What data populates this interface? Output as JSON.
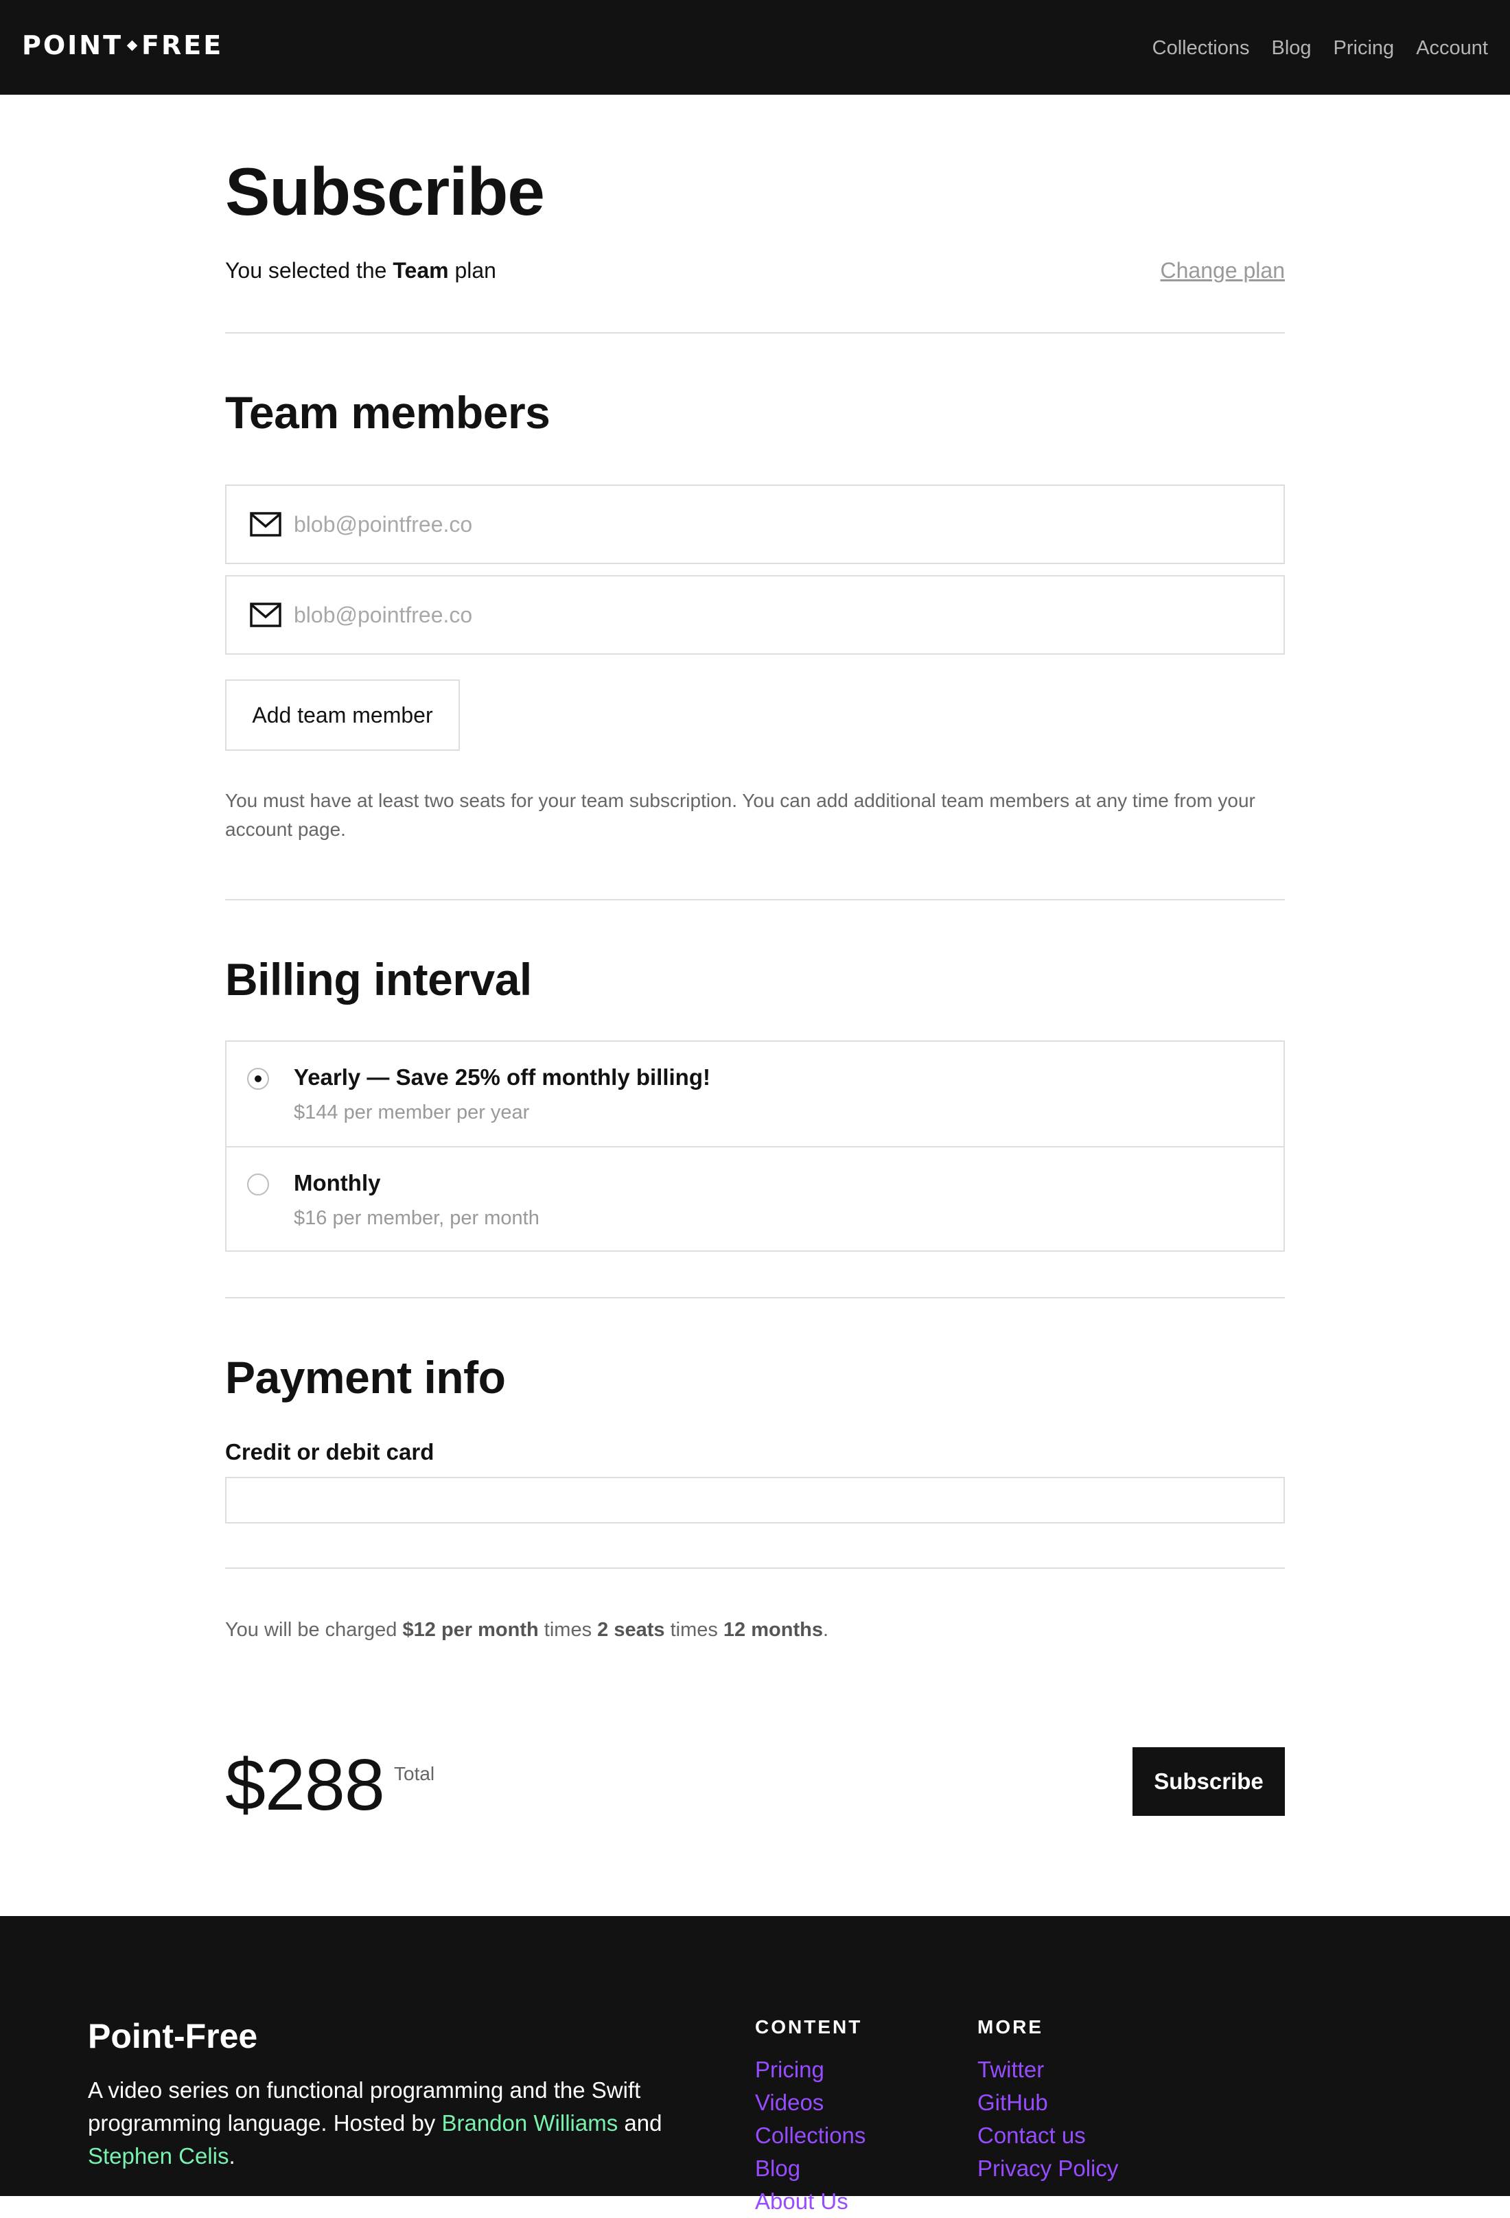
{
  "header": {
    "logo_left": "POINT",
    "logo_right": "FREE",
    "nav": [
      "Collections",
      "Blog",
      "Pricing",
      "Account"
    ]
  },
  "subscribe": {
    "title": "Subscribe",
    "plan_prefix": "You selected the",
    "plan_name": "Team",
    "plan_suffix": "plan",
    "change_plan": "Change plan"
  },
  "team": {
    "title": "Team members",
    "emails": [
      {
        "value": "",
        "placeholder": "blob@pointfree.co"
      },
      {
        "value": "",
        "placeholder": "blob@pointfree.co"
      }
    ],
    "add_button": "Add team member",
    "note": "You must have at least two seats for your team subscription. You can add additional team members at any time from your account page."
  },
  "billing": {
    "title": "Billing interval",
    "options": [
      {
        "title": "Yearly — Save 25% off monthly billing!",
        "subtitle": "$144 per member per year",
        "selected": true
      },
      {
        "title": "Monthly",
        "subtitle": "$16 per member, per month",
        "selected": false
      }
    ]
  },
  "payment": {
    "title": "Payment info",
    "card_label": "Credit or debit card",
    "card_value": ""
  },
  "summary": {
    "prefix": "You will be charged",
    "rate": "$12 per month",
    "times1": "times",
    "seats": "2 seats",
    "times2": "times",
    "months": "12 months",
    "end": ".",
    "total": "$288",
    "total_label": "Total",
    "subscribe_button": "Subscribe"
  },
  "footer": {
    "brand": "Point-Free",
    "desc_prefix": "A video series on functional programming and the Swift programming language. Hosted by",
    "host1": "Brandon Williams",
    "and": "and",
    "host2": "Stephen Celis",
    "desc_end": ".",
    "content": {
      "heading": "CONTENT",
      "links": [
        "Pricing",
        "Videos",
        "Collections",
        "Blog",
        "About Us"
      ]
    },
    "more": {
      "heading": "MORE",
      "links": [
        "Twitter",
        "GitHub",
        "Contact us",
        "Privacy Policy"
      ]
    }
  },
  "colors": {
    "dark": "#121212",
    "border": "#dddddd",
    "link_purple": "#974dff",
    "link_green": "#79f2b0"
  },
  "icons": [
    "mail-icon",
    "radio-checked-icon",
    "radio-unchecked-icon"
  ]
}
